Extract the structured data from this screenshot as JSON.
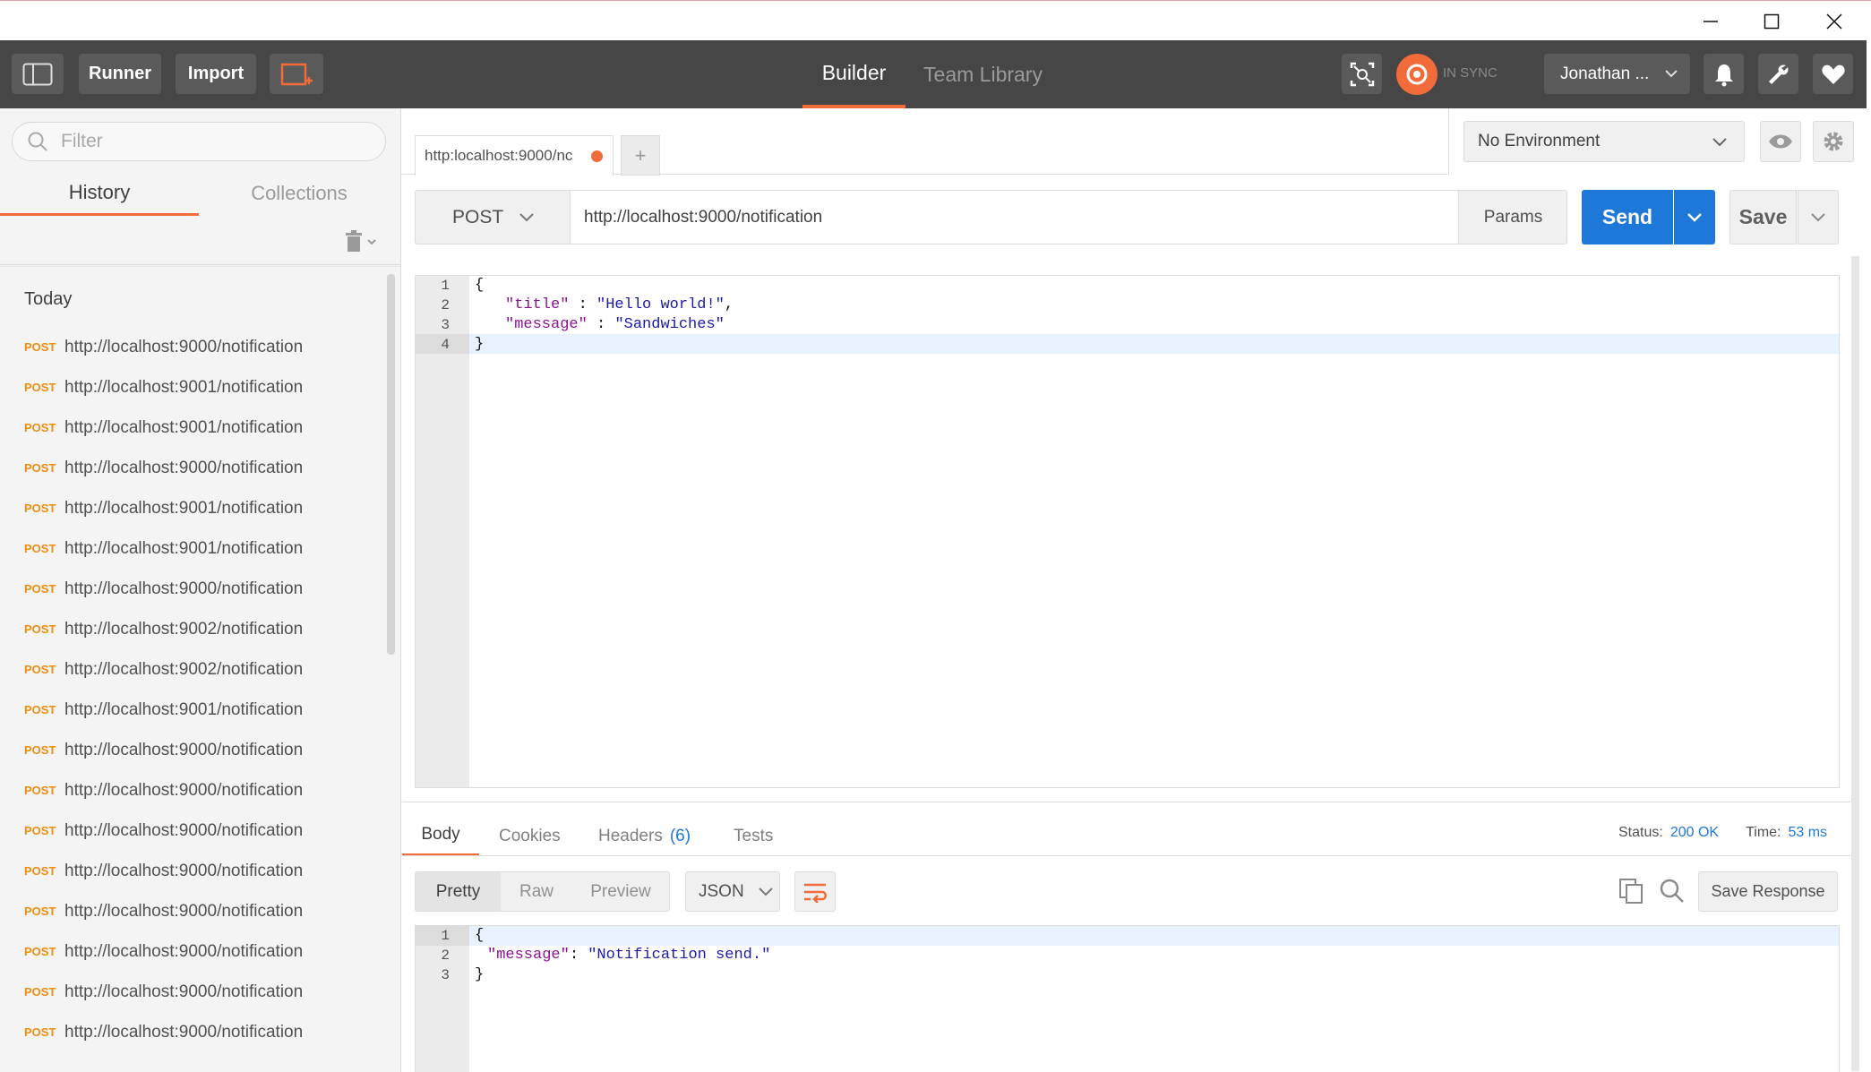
{
  "window": {
    "minimize_icon": "minimize-icon",
    "maximize_icon": "maximize-icon",
    "close_icon": "close-icon"
  },
  "header": {
    "runner_label": "Runner",
    "import_label": "Import",
    "tabs": [
      "Builder",
      "Team Library"
    ],
    "sync_status": "IN SYNC",
    "user_name": "Jonathan ...",
    "accent_color": "#f26b3a"
  },
  "sidebar": {
    "filter_placeholder": "Filter",
    "tabs": [
      "History",
      "Collections"
    ],
    "group_label": "Today",
    "history": [
      {
        "method": "POST",
        "url": "http://localhost:9000/notification"
      },
      {
        "method": "POST",
        "url": "http://localhost:9001/notification"
      },
      {
        "method": "POST",
        "url": "http://localhost:9001/notification"
      },
      {
        "method": "POST",
        "url": "http://localhost:9000/notification"
      },
      {
        "method": "POST",
        "url": "http://localhost:9001/notification"
      },
      {
        "method": "POST",
        "url": "http://localhost:9001/notification"
      },
      {
        "method": "POST",
        "url": "http://localhost:9000/notification"
      },
      {
        "method": "POST",
        "url": "http://localhost:9002/notification"
      },
      {
        "method": "POST",
        "url": "http://localhost:9002/notification"
      },
      {
        "method": "POST",
        "url": "http://localhost:9001/notification"
      },
      {
        "method": "POST",
        "url": "http://localhost:9000/notification"
      },
      {
        "method": "POST",
        "url": "http://localhost:9000/notification"
      },
      {
        "method": "POST",
        "url": "http://localhost:9000/notification"
      },
      {
        "method": "POST",
        "url": "http://localhost:9000/notification"
      },
      {
        "method": "POST",
        "url": "http://localhost:9000/notification"
      },
      {
        "method": "POST",
        "url": "http://localhost:9000/notification"
      },
      {
        "method": "POST",
        "url": "http://localhost:9000/notification"
      },
      {
        "method": "POST",
        "url": "http://localhost:9000/notification"
      }
    ]
  },
  "request": {
    "tab_title": "http:localhost:9000/nc",
    "environment": "No Environment",
    "method": "POST",
    "url": "http://localhost:9000/notification",
    "params_label": "Params",
    "send_label": "Send",
    "save_label": "Save",
    "body_lines": [
      {
        "n": "1",
        "text": "{"
      },
      {
        "n": "2",
        "key": "\"title\"",
        "sep": " : ",
        "val": "\"Hello world!\"",
        "end": ","
      },
      {
        "n": "3",
        "key": "\"message\"",
        "sep": " : ",
        "val": "\"Sandwiches\"",
        "end": ""
      },
      {
        "n": "4",
        "text": "}"
      }
    ]
  },
  "response": {
    "tabs": [
      "Body",
      "Cookies",
      "Headers",
      "Tests"
    ],
    "headers_count": "(6)",
    "status_label": "Status:",
    "status_value": "200 OK",
    "time_label": "Time:",
    "time_value": "53 ms",
    "view_modes": [
      "Pretty",
      "Raw",
      "Preview"
    ],
    "format": "JSON",
    "save_response_label": "Save Response",
    "body_lines": [
      {
        "n": "1",
        "text": "{"
      },
      {
        "n": "2",
        "key": "\"message\"",
        "sep": ": ",
        "val": "\"Notification send.\"",
        "end": ""
      },
      {
        "n": "3",
        "text": "}"
      }
    ]
  }
}
